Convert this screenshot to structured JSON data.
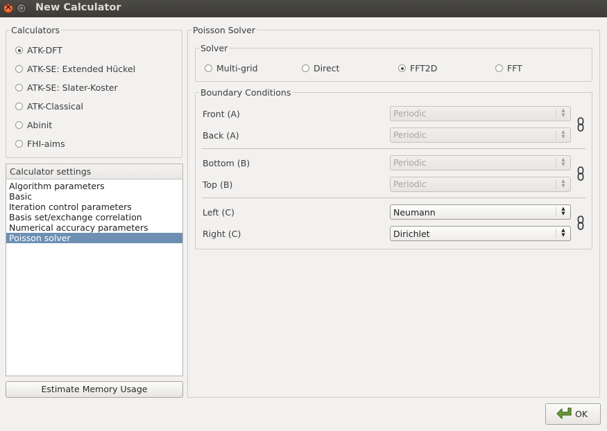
{
  "window": {
    "title": "New Calculator"
  },
  "calculators": {
    "legend": "Calculators",
    "items": [
      {
        "label": "ATK-DFT",
        "checked": true
      },
      {
        "label": "ATK-SE: Extended Hückel",
        "checked": false
      },
      {
        "label": "ATK-SE: Slater-Koster",
        "checked": false
      },
      {
        "label": "ATK-Classical",
        "checked": false
      },
      {
        "label": "Abinit",
        "checked": false
      },
      {
        "label": "FHI-aims",
        "checked": false
      }
    ]
  },
  "settings": {
    "header": "Calculator settings",
    "items": [
      "Algorithm parameters",
      "Basic",
      "Iteration control parameters",
      "Basis set/exchange correlation",
      "Numerical accuracy parameters",
      "Poisson solver"
    ],
    "selected": "Poisson solver"
  },
  "estimate_button": "Estimate Memory Usage",
  "poisson": {
    "legend": "Poisson Solver",
    "solver": {
      "legend": "Solver",
      "options": [
        {
          "label": "Multi-grid",
          "checked": false
        },
        {
          "label": "Direct",
          "checked": false
        },
        {
          "label": "FFT2D",
          "checked": true
        },
        {
          "label": "FFT",
          "checked": false
        }
      ]
    },
    "boundary": {
      "legend": "Boundary Conditions",
      "rows": [
        {
          "label": "Front (A)",
          "value": "Periodic",
          "enabled": false
        },
        {
          "label": "Back (A)",
          "value": "Periodic",
          "enabled": false
        },
        {
          "label": "Bottom (B)",
          "value": "Periodic",
          "enabled": false
        },
        {
          "label": "Top (B)",
          "value": "Periodic",
          "enabled": false
        },
        {
          "label": "Left (C)",
          "value": "Neumann",
          "enabled": true
        },
        {
          "label": "Right (C)",
          "value": "Dirichlet",
          "enabled": true
        }
      ]
    }
  },
  "ok_button": "OK",
  "colors": {
    "selection": "#6d8fb3",
    "titlebar": "#3c3b37",
    "close": "#e0501f",
    "ok_arrow": "#5a8a2e"
  },
  "icons": {
    "close": "close-icon",
    "minimize": "minimize-icon",
    "link": "chain-link-icon",
    "ok": "ok-arrow-icon"
  }
}
